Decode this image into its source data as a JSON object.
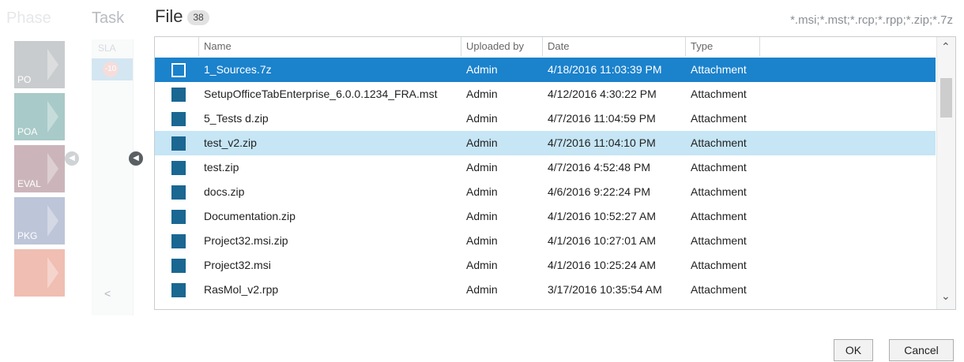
{
  "background": {
    "phase_title": "Phase",
    "phase_items": [
      {
        "label": "PO",
        "color": "#8a8f93"
      },
      {
        "label": "POA",
        "color": "#3f8b87"
      },
      {
        "label": "EVAL",
        "color": "#8d5c69"
      },
      {
        "label": "PKG",
        "color": "#6f7fa9"
      },
      {
        "label": "",
        "color": "#e07057"
      }
    ],
    "phase_collapse_icon": "chevron-left-circle-icon",
    "task_title": "Task",
    "task_sla_header": "SLA",
    "task_sla_badge": "-10",
    "task_collapse_icon": "chevron-left-circle-icon",
    "task_scroll_left": "<"
  },
  "dialog": {
    "title": "File",
    "count": "38",
    "filter": "*.msi;*.mst;*.rcp;*.rpp;*.zip;*.7z",
    "columns": {
      "name": "Name",
      "uploaded_by": "Uploaded by",
      "date": "Date",
      "type": "Type"
    },
    "rows": [
      {
        "name": "1_Sources.7z",
        "uploaded_by": "Admin",
        "date": "4/18/2016 11:03:39 PM",
        "type": "Attachment",
        "state": "selected"
      },
      {
        "name": "SetupOfficeTabEnterprise_6.0.0.1234_FRA.mst",
        "uploaded_by": "Admin",
        "date": "4/12/2016 4:30:22 PM",
        "type": "Attachment",
        "state": ""
      },
      {
        "name": "5_Tests d.zip",
        "uploaded_by": "Admin",
        "date": "4/7/2016 11:04:59 PM",
        "type": "Attachment",
        "state": ""
      },
      {
        "name": "test_v2.zip",
        "uploaded_by": "Admin",
        "date": "4/7/2016 11:04:10 PM",
        "type": "Attachment",
        "state": "hover"
      },
      {
        "name": "test.zip",
        "uploaded_by": "Admin",
        "date": "4/7/2016 4:52:48 PM",
        "type": "Attachment",
        "state": ""
      },
      {
        "name": "docs.zip",
        "uploaded_by": "Admin",
        "date": "4/6/2016 9:22:24 PM",
        "type": "Attachment",
        "state": ""
      },
      {
        "name": "Documentation.zip",
        "uploaded_by": "Admin",
        "date": "4/1/2016 10:52:27 AM",
        "type": "Attachment",
        "state": ""
      },
      {
        "name": "Project32.msi.zip",
        "uploaded_by": "Admin",
        "date": "4/1/2016 10:27:01 AM",
        "type": "Attachment",
        "state": ""
      },
      {
        "name": "Project32.msi",
        "uploaded_by": "Admin",
        "date": "4/1/2016 10:25:24 AM",
        "type": "Attachment",
        "state": ""
      },
      {
        "name": "RasMol_v2.rpp",
        "uploaded_by": "Admin",
        "date": "3/17/2016 10:35:54 AM",
        "type": "Attachment",
        "state": ""
      }
    ],
    "file_icon": "file-square-icon",
    "scroll_up": "^",
    "scroll_down": "v",
    "ok_label": "OK",
    "cancel_label": "Cancel"
  },
  "colors": {
    "selected_row": "#1b82cc",
    "hover_row": "#c6e5f5",
    "file_icon": "#1a6792"
  }
}
